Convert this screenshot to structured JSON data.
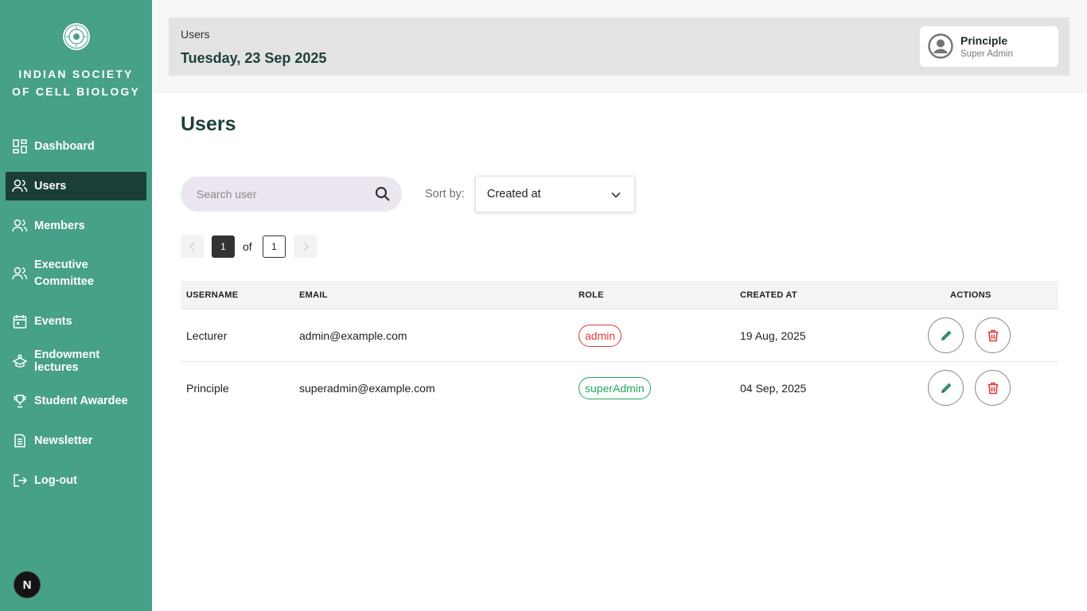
{
  "sidebar": {
    "org_name": "INDIAN SOCIETY\nOF CELL BIOLOGY",
    "logo_icon": "society-seal-logo",
    "items": [
      {
        "label": "Dashboard",
        "icon": "dashboard-grid-icon",
        "active": false
      },
      {
        "label": "Users",
        "icon": "users-icon",
        "active": true
      },
      {
        "label": "Members",
        "icon": "members-icon",
        "active": false
      },
      {
        "label": "Executive\nCommittee",
        "icon": "committee-icon",
        "active": false
      },
      {
        "label": "Events",
        "icon": "calendar-icon",
        "active": false
      },
      {
        "label": "Endowment lectures",
        "icon": "lecture-icon",
        "active": false
      },
      {
        "label": "Student Awardee",
        "icon": "trophy-icon",
        "active": false
      },
      {
        "label": "Newsletter",
        "icon": "newsletter-icon",
        "active": false
      },
      {
        "label": "Log-out",
        "icon": "logout-icon",
        "active": false
      }
    ],
    "dev_badge": "N"
  },
  "header": {
    "breadcrumb": "Users",
    "date": "Tuesday, 23 Sep 2025",
    "profile": {
      "name": "Principle",
      "role": "Super Admin"
    }
  },
  "main": {
    "title": "Users",
    "search": {
      "placeholder": "Search user",
      "value": ""
    },
    "sort": {
      "label": "Sort by:",
      "selected": "Created at"
    },
    "pagination": {
      "current": "1",
      "of_label": "of",
      "total": "1"
    },
    "table": {
      "columns": [
        "USERNAME",
        "EMAIL",
        "ROLE",
        "CREATED AT",
        "ACTIONS"
      ],
      "rows": [
        {
          "username": "Lecturer",
          "email": "admin@example.com",
          "role": "admin",
          "created_at": "19 Aug, 2025"
        },
        {
          "username": "Principle",
          "email": "superadmin@example.com",
          "role": "superAdmin",
          "created_at": "04 Sep, 2025"
        }
      ]
    }
  },
  "colors": {
    "sidebar_bg": "#47a088",
    "sidebar_active": "#1b3f37",
    "role_admin": "#e03b3b",
    "role_superadmin": "#22a65e",
    "edit_icon": "#3a8f74",
    "delete_icon": "#e03b3b"
  }
}
